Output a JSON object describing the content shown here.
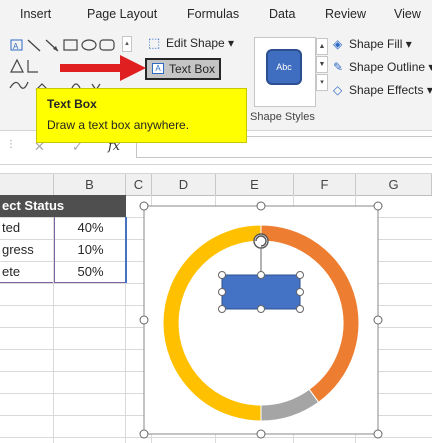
{
  "ribbon": {
    "tabs": [
      "Insert",
      "Page Layout",
      "Formulas",
      "Data",
      "Review",
      "View"
    ],
    "edit_shape_label": "Edit Shape",
    "text_box_label": "Text Box",
    "abc_label": "Abc",
    "shape_fill_label": "Shape Fill",
    "shape_outline_label": "Shape Outline",
    "shape_effects_label": "Shape Effects",
    "shape_styles_group": "Shape Styles"
  },
  "tooltip": {
    "title": "Text Box",
    "description": "Draw a text box anywhere."
  },
  "formula_bar": {
    "cancel": "✕",
    "enter": "✓",
    "fx": "fx",
    "value": ""
  },
  "grid": {
    "columns": [
      "B",
      "C",
      "D",
      "E",
      "F",
      "G"
    ],
    "header": "ect Status",
    "rows": [
      {
        "label": "ted",
        "value": "40%"
      },
      {
        "label": "gress",
        "value": "10%"
      },
      {
        "label": "ete",
        "value": "50%"
      }
    ]
  },
  "chart_data": {
    "type": "pie",
    "variant": "doughnut",
    "categories": [
      "Completed",
      "In Progress",
      "Incomplete"
    ],
    "values": [
      40,
      10,
      50
    ],
    "colors": [
      "#ed7d31",
      "#a5a5a5",
      "#ffc000"
    ],
    "title": ""
  },
  "colors": {
    "accent_blue": "#4472c4",
    "tooltip_yellow": "#ffff00",
    "arrow_red": "#e02020"
  }
}
